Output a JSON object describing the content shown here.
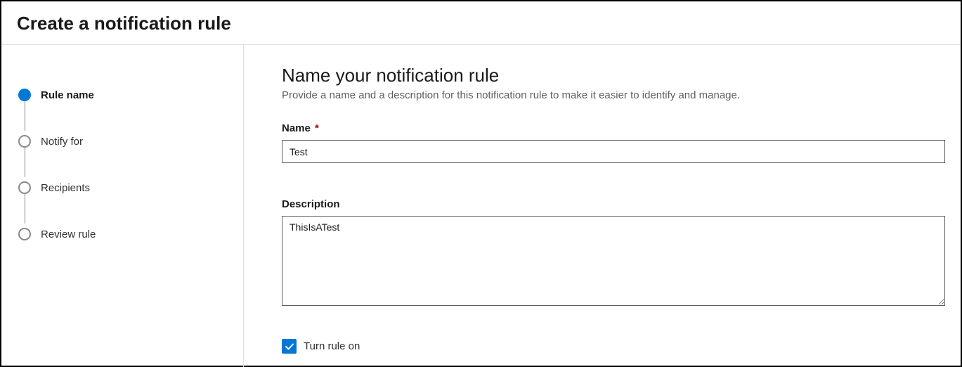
{
  "header": {
    "title": "Create a notification rule"
  },
  "sidebar": {
    "steps": [
      {
        "label": "Rule name",
        "active": true
      },
      {
        "label": "Notify for",
        "active": false
      },
      {
        "label": "Recipients",
        "active": false
      },
      {
        "label": "Review rule",
        "active": false
      }
    ]
  },
  "main": {
    "section_title": "Name your notification rule",
    "section_desc": "Provide a name and a description for this notification rule to make it easier to identify and manage.",
    "name": {
      "label": "Name",
      "required_mark": "*",
      "value": "Test"
    },
    "description": {
      "label": "Description",
      "value": "ThisIsATest"
    },
    "turn_on": {
      "label": "Turn rule on",
      "checked": true
    }
  }
}
